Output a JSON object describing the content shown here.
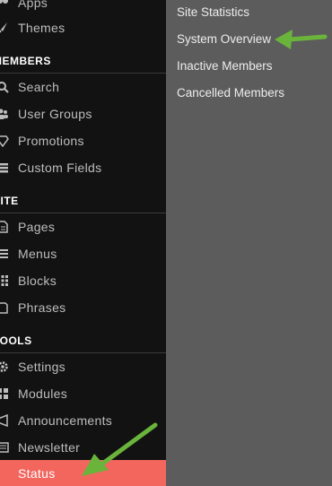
{
  "sidebar": {
    "items": [
      {
        "label": "Apps",
        "icon": "apps-icon"
      },
      {
        "label": "Themes",
        "icon": "brush-icon"
      },
      {
        "label": "Search",
        "icon": "search-icon"
      },
      {
        "label": "User Groups",
        "icon": "users-icon"
      },
      {
        "label": "Promotions",
        "icon": "diamond-icon"
      },
      {
        "label": "Custom Fields",
        "icon": "list-icon"
      },
      {
        "label": "Pages",
        "icon": "page-icon"
      },
      {
        "label": "Menus",
        "icon": "menu-icon"
      },
      {
        "label": "Blocks",
        "icon": "blocks-icon"
      },
      {
        "label": "Phrases",
        "icon": "book-icon"
      },
      {
        "label": "Settings",
        "icon": "gear-icon"
      },
      {
        "label": "Modules",
        "icon": "modules-icon"
      },
      {
        "label": "Announcements",
        "icon": "megaphone-icon"
      },
      {
        "label": "Newsletter",
        "icon": "newsletter-icon"
      },
      {
        "label": "Status",
        "icon": "status-icon",
        "active": true
      }
    ],
    "sections": {
      "members": "MEMBERS",
      "site": "SITE",
      "tools": "TOOLS"
    }
  },
  "submenu": {
    "items": [
      "Site Statistics",
      "System Overview",
      "Inactive Members",
      "Cancelled Members"
    ]
  },
  "colors": {
    "sidebar_bg": "#121212",
    "content_bg": "#5c5c5c",
    "active": "#f2665e",
    "arrow": "#6ab43c"
  }
}
